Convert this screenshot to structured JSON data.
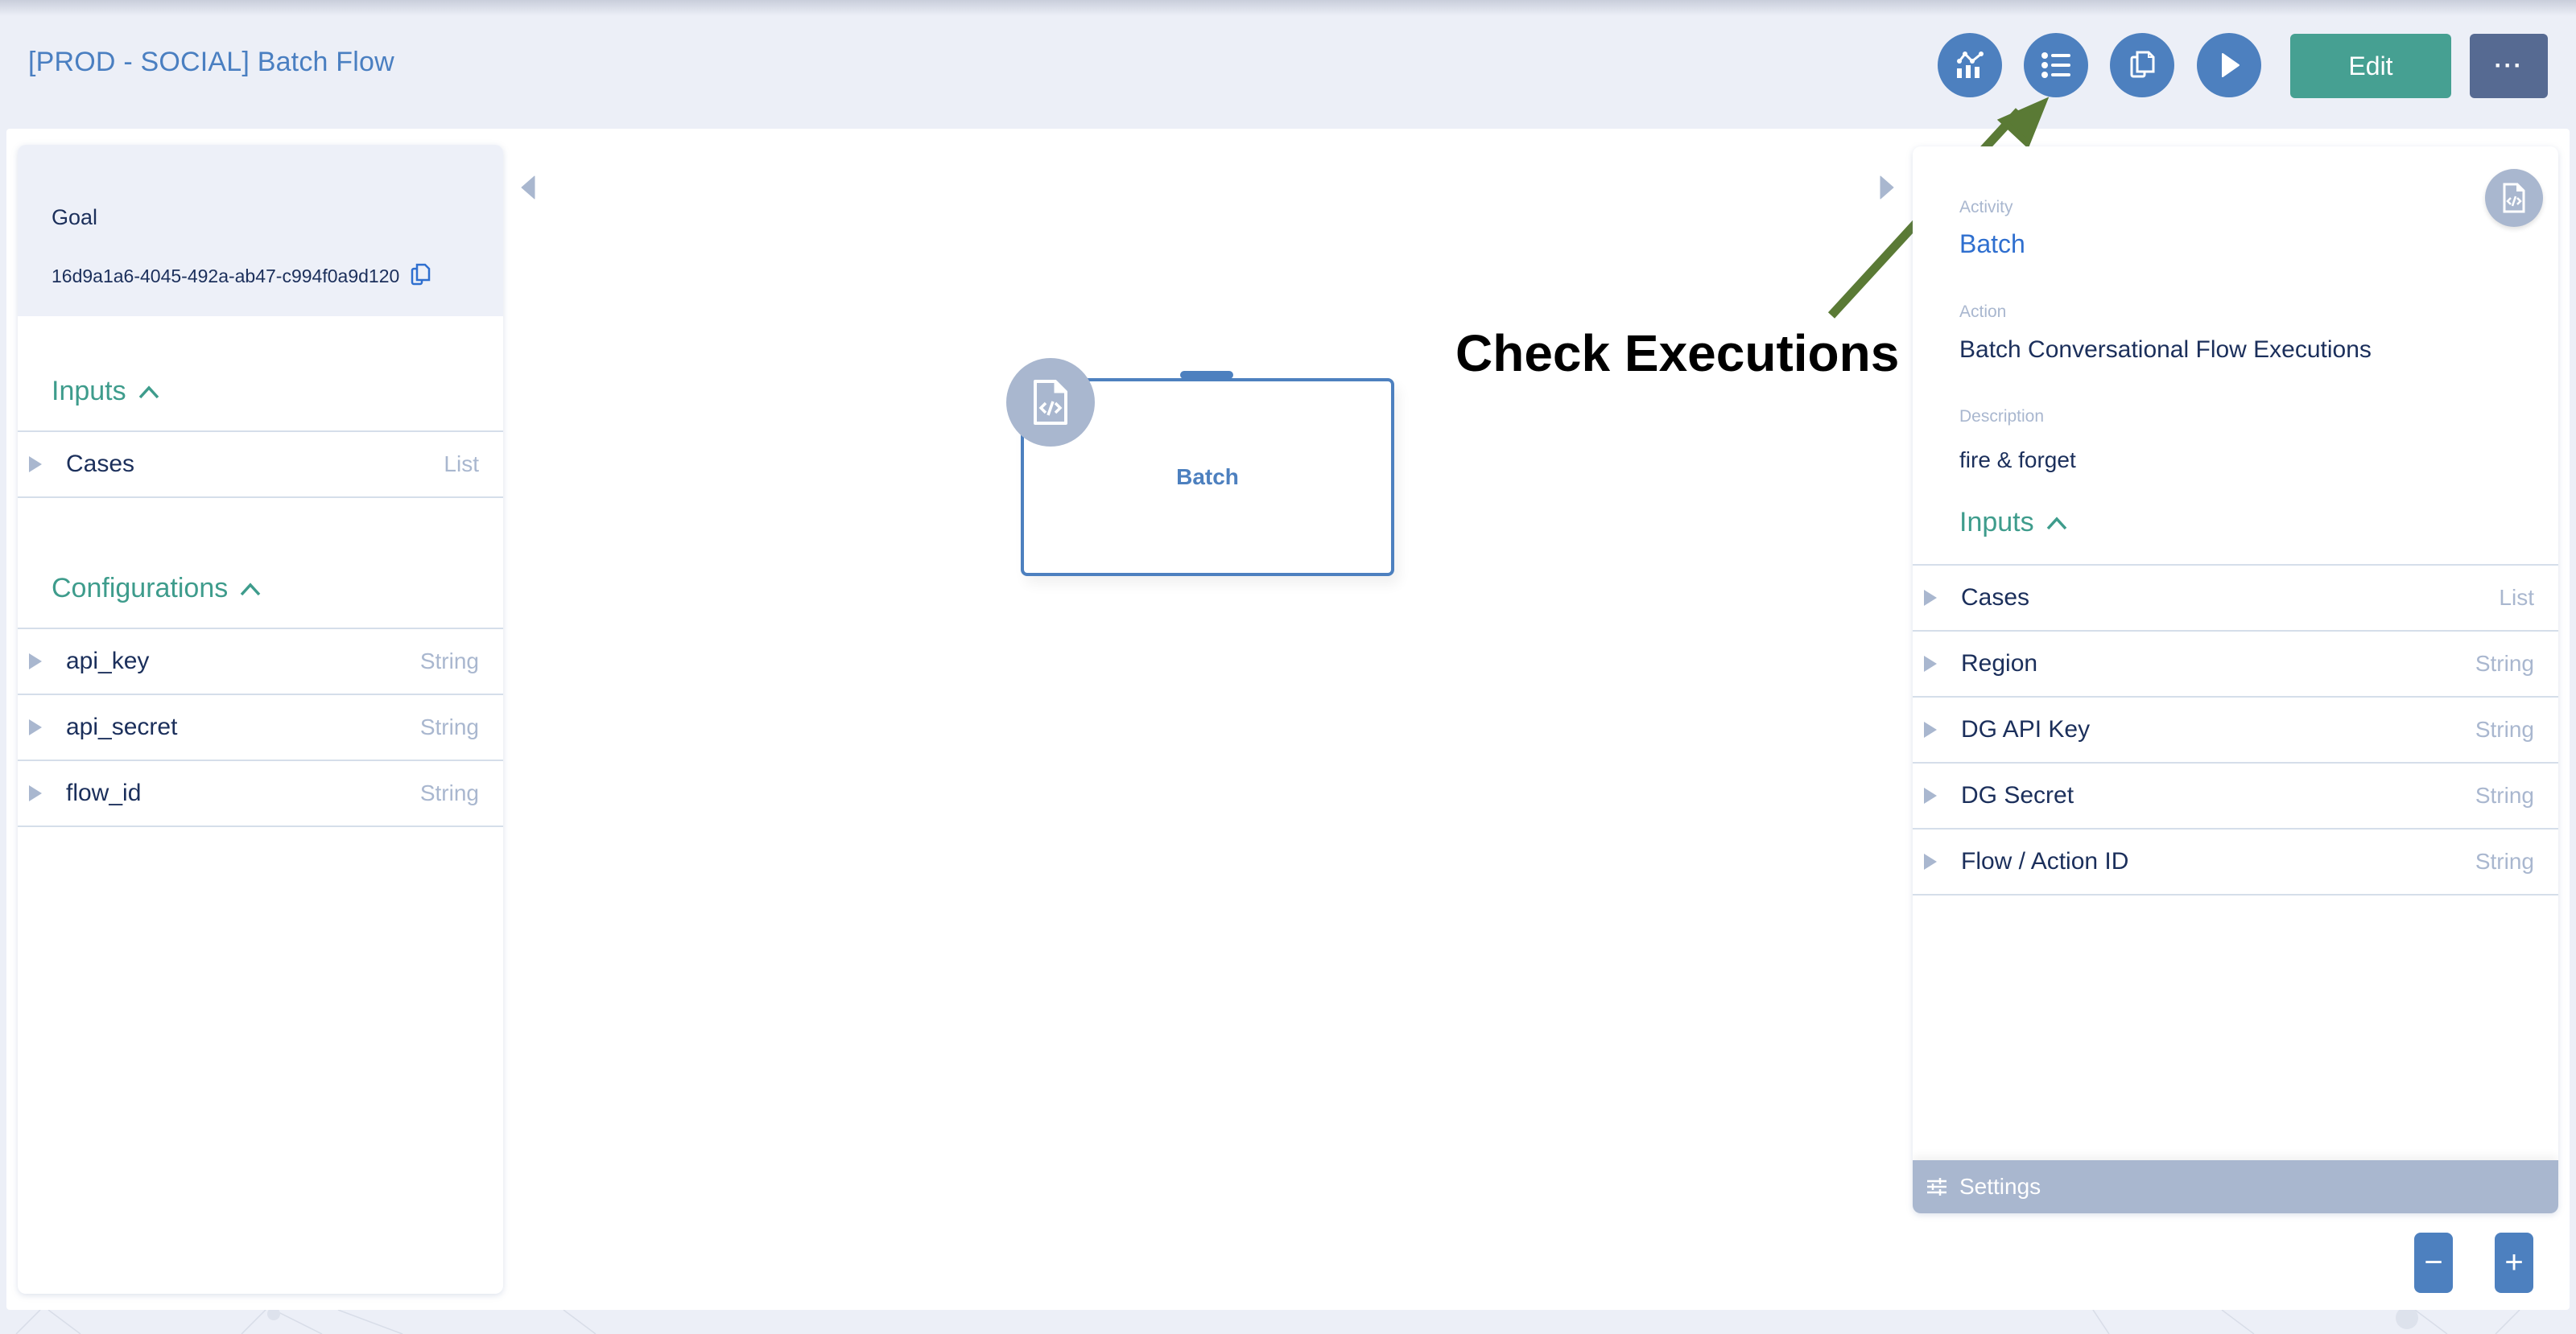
{
  "header": {
    "title": "[PROD - SOCIAL] Batch Flow",
    "toolbar": [
      {
        "name": "analytics-button",
        "icon": "chart-icon"
      },
      {
        "name": "executions-button",
        "icon": "list-icon"
      },
      {
        "name": "duplicate-button",
        "icon": "copy-icon"
      },
      {
        "name": "run-button",
        "icon": "play-icon"
      }
    ],
    "edit_label": "Edit",
    "more_label": "···"
  },
  "colors": {
    "primary": "#4d80bf",
    "teal": "#46a092",
    "slate": "#566a92",
    "muted": "#a9b7cf",
    "annotation_arrow": "#5a7a35"
  },
  "left_panel": {
    "goal_label": "Goal",
    "goal_id": "16d9a1a6-4045-492a-ab47-c994f0a9d120",
    "inputs_title": "Inputs",
    "inputs": [
      {
        "name": "Cases",
        "type": "List"
      }
    ],
    "configurations_title": "Configurations",
    "configurations": [
      {
        "name": "api_key",
        "type": "String"
      },
      {
        "name": "api_secret",
        "type": "String"
      },
      {
        "name": "flow_id",
        "type": "String"
      }
    ]
  },
  "canvas": {
    "node_label": "Batch",
    "annotation": "Check Executions"
  },
  "right_panel": {
    "activity_label": "Activity",
    "activity_value": "Batch",
    "action_label": "Action",
    "action_value": "Batch Conversational Flow Executions",
    "description_label": "Description",
    "description_value": "fire & forget",
    "inputs_title": "Inputs",
    "inputs": [
      {
        "name": "Cases",
        "type": "List"
      },
      {
        "name": "Region",
        "type": "String"
      },
      {
        "name": "DG API Key",
        "type": "String"
      },
      {
        "name": "DG Secret",
        "type": "String"
      },
      {
        "name": "Flow / Action ID",
        "type": "String"
      }
    ],
    "settings_label": "Settings"
  },
  "zoom_controls": {
    "zoom_out_label": "−",
    "zoom_in_label": "+"
  }
}
